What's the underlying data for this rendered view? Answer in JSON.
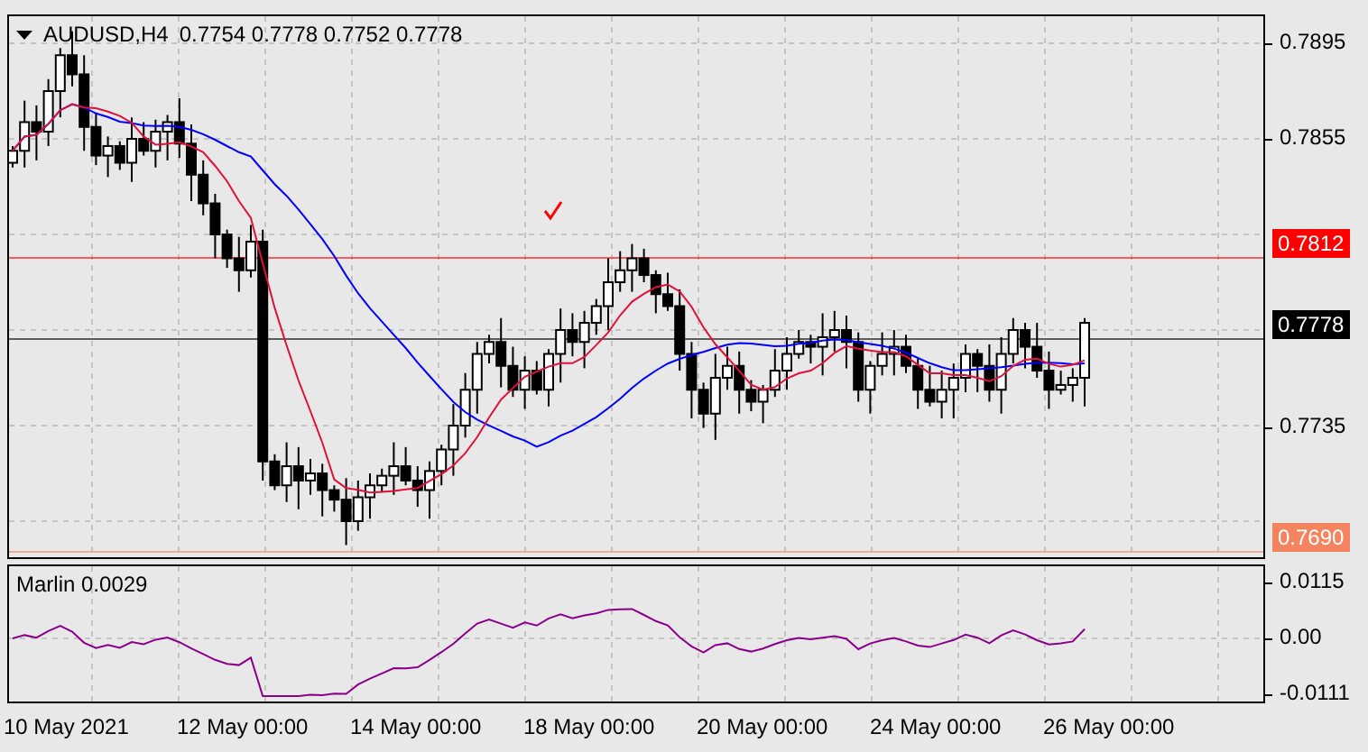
{
  "chart": {
    "symbol": "AUDUSD,H4",
    "quote": "0.7754 0.7778 0.7752 0.7778",
    "price_labels": [
      "0.7895",
      "0.7855",
      "0.7735"
    ],
    "price_tags": [
      {
        "text": "0.7812",
        "color": "#ff0000"
      },
      {
        "text": "0.7778",
        "color": "#000000"
      },
      {
        "text": "0.7690",
        "color": "#f4845f"
      }
    ]
  },
  "indicator": {
    "label": "Marlin 0.0029",
    "scale_labels": [
      "0.0115",
      "0.00",
      "-0.0111"
    ]
  },
  "time_axis": {
    "labels": [
      "10 May 2021",
      "12 May 00:00",
      "14 May 00:00",
      "18 May 00:00",
      "20 May 00:00",
      "24 May 00:00",
      "26 May 00:00"
    ]
  }
}
